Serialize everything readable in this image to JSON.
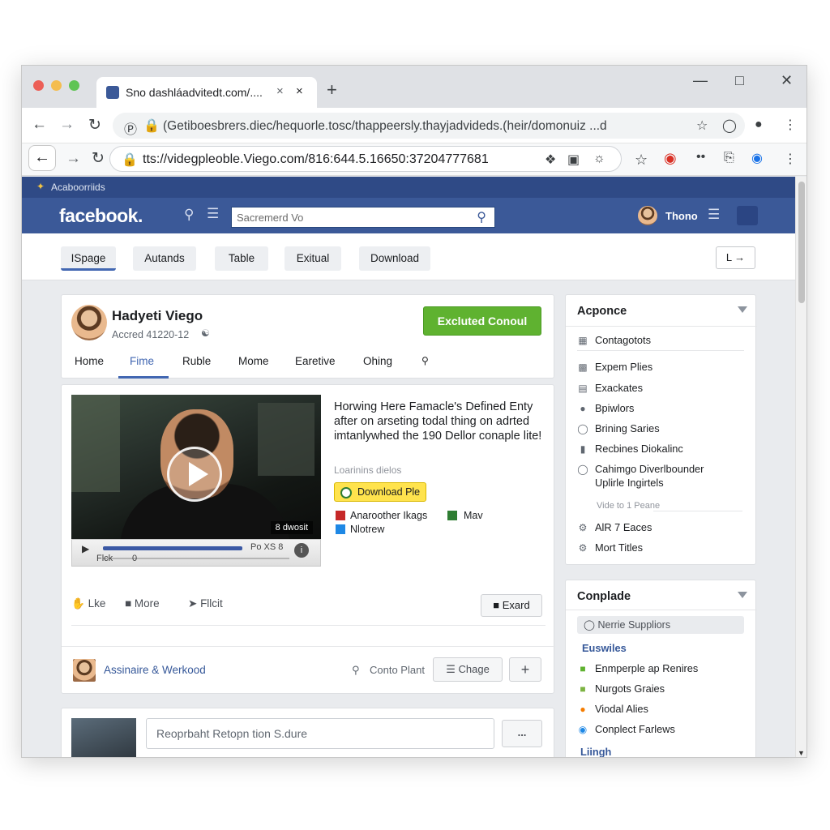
{
  "browser": {
    "tab_title": "Sno dashláadvitedt.com/....",
    "tab_close": "×",
    "tab_close2": "×",
    "new_tab": "+",
    "url_bar1": "(Getiboesbrers.diec/hequorle.tosc/thappeersly.thayjadvideds.(heir/domonuiz ...d",
    "url_bar2": "tts://videgpleoble.Viego.com/816:644.5.16650:37204777681"
  },
  "facebook": {
    "strip_text": "Acaboorriids",
    "logo": "facebook.",
    "search_placeholder": "Sacremerd Vo",
    "user_name": "Thono",
    "subnav": [
      "ISpage",
      "Autands",
      "Table",
      "Exitual",
      "Download"
    ],
    "subnav_right": "L →",
    "profile": {
      "name": "Hadyeti Viego",
      "sub": "Accred 41220-12",
      "action_button": "Excluted Conoul",
      "tabs": [
        "Home",
        "Fime",
        "Ruble",
        "Mome",
        "Earetive",
        "Ohing"
      ]
    },
    "post": {
      "title": "Horwing Here Famacle's Defined Enty after on arseting todal thing on adrted imtanlywhed the 190 Dellor conaple lite!",
      "meta": "Loarinins dielos",
      "download_button": "Download Ple",
      "tag1": "Anaroother Ikags",
      "tag2": "Nlotrew",
      "tag3": "Mav",
      "video_badge": "8 dwosit",
      "video_time_left": "Flck",
      "video_time_zero": "0",
      "video_time_right": "Po XS 8",
      "actions": [
        "Lke",
        "More",
        "Fllcit"
      ],
      "expand_button": "Exard",
      "commenter": "Assinaire & Werkood",
      "contact": "Conto Plant",
      "change_button": "Chage",
      "plus_button": "+"
    },
    "composer": {
      "placeholder": "Reoprbaht Retopn tion S.dure",
      "more_button": "..."
    },
    "sidebar1": {
      "title": "Acponce",
      "items": [
        "Contagotots",
        "Expem Plies",
        "Exackates",
        "Bpiwlors",
        "Brining Saries",
        "Recbines Diokalinc",
        "Cahimgo Diverlbounder",
        "Uplirle Ingirtels"
      ],
      "small": "Vide to 1 Peane",
      "items2": [
        "AlR 7 Eaces",
        "Mort Titles"
      ]
    },
    "sidebar2": {
      "title": "Conplade",
      "pill": "Nerrie Suppliors",
      "link": "Euswiles",
      "items": [
        "Enmperple ap Renires",
        "Nurgots Graies",
        "Viodal Alies",
        "Conplect Farlews"
      ],
      "link2": "Liingh"
    }
  },
  "colors": {
    "fb_blue": "#3b5998",
    "green": "#5fb230",
    "yellow": "#ffe34d",
    "link": "#365899"
  },
  "icons": [
    "back-icon",
    "forward-icon",
    "reload-icon",
    "lock-icon",
    "star-icon",
    "search-icon",
    "menu-icon",
    "play-icon",
    "like-icon",
    "share-icon"
  ]
}
